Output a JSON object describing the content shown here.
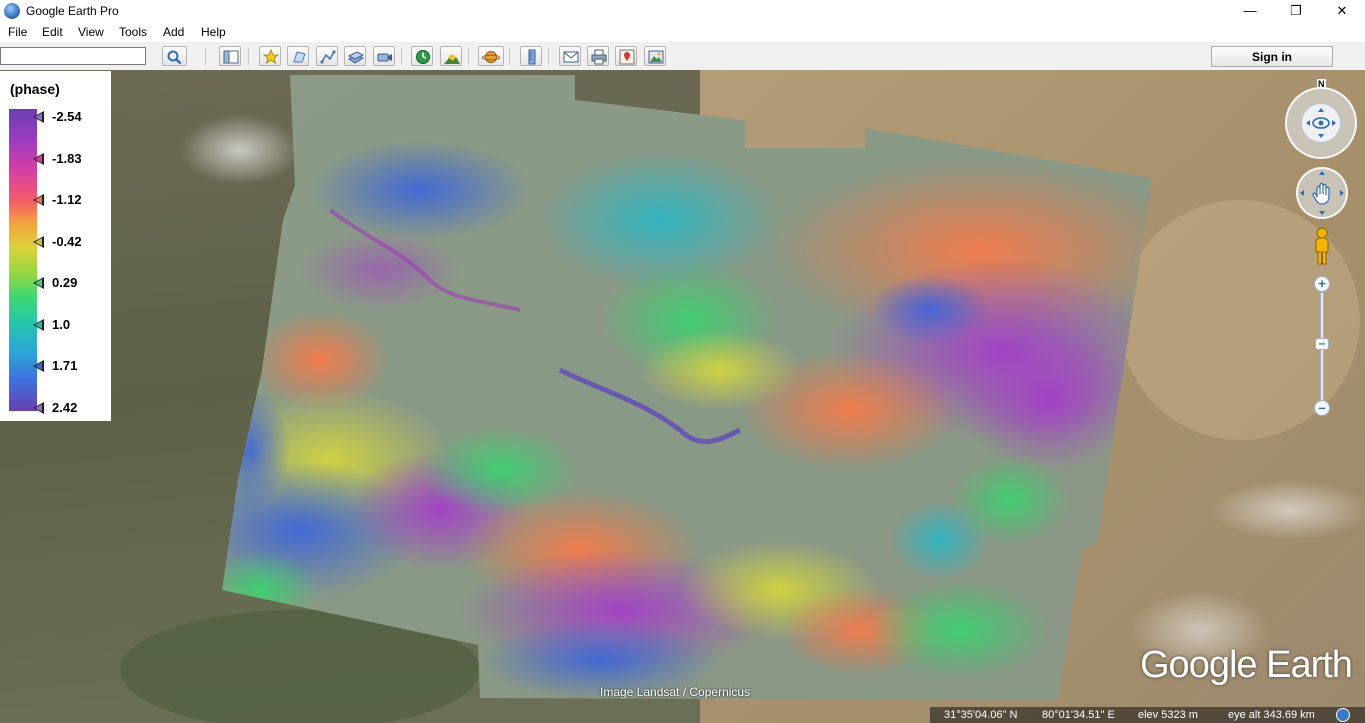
{
  "window": {
    "title": "Google Earth Pro",
    "min": "—",
    "max": "❐",
    "close": "✕"
  },
  "menu": [
    "File",
    "Edit",
    "View",
    "Tools",
    "Add",
    "Help"
  ],
  "search": {
    "value": "",
    "placeholder": ""
  },
  "toolbar": {
    "icons": [
      "search-icon",
      "sidebar-toggle-icon",
      "placemark-icon",
      "polygon-icon",
      "path-icon",
      "overlay-icon",
      "tour-icon",
      "historical-imagery-icon",
      "sunlight-icon",
      "planet-icon",
      "ruler-icon",
      "email-icon",
      "print-icon",
      "google-maps-icon",
      "save-image-icon"
    ],
    "sign_in_label": "Sign in"
  },
  "legend": {
    "title": "(phase)",
    "ticks": [
      {
        "label": "-2.54",
        "color": "#8d6cc9"
      },
      {
        "label": "-1.83",
        "color": "#d83c8c"
      },
      {
        "label": "-1.12",
        "color": "#f07b4a"
      },
      {
        "label": "-0.42",
        "color": "#c9c235"
      },
      {
        "label": "0.29",
        "color": "#3ed46f"
      },
      {
        "label": "1.0",
        "color": "#22b9a0"
      },
      {
        "label": "1.71",
        "color": "#3d68dc"
      },
      {
        "label": "2.42",
        "color": "#8d6cc9"
      }
    ]
  },
  "compass": {
    "north_label": "N"
  },
  "map": {
    "attribution": "Image Landsat / Copernicus",
    "brand": "Google Earth"
  },
  "status": {
    "lat": "31°35'04.06\" N",
    "lon": "80°01'34.51\" E",
    "elev": "elev  5323 m",
    "eye": "eye alt 343.69 km"
  }
}
